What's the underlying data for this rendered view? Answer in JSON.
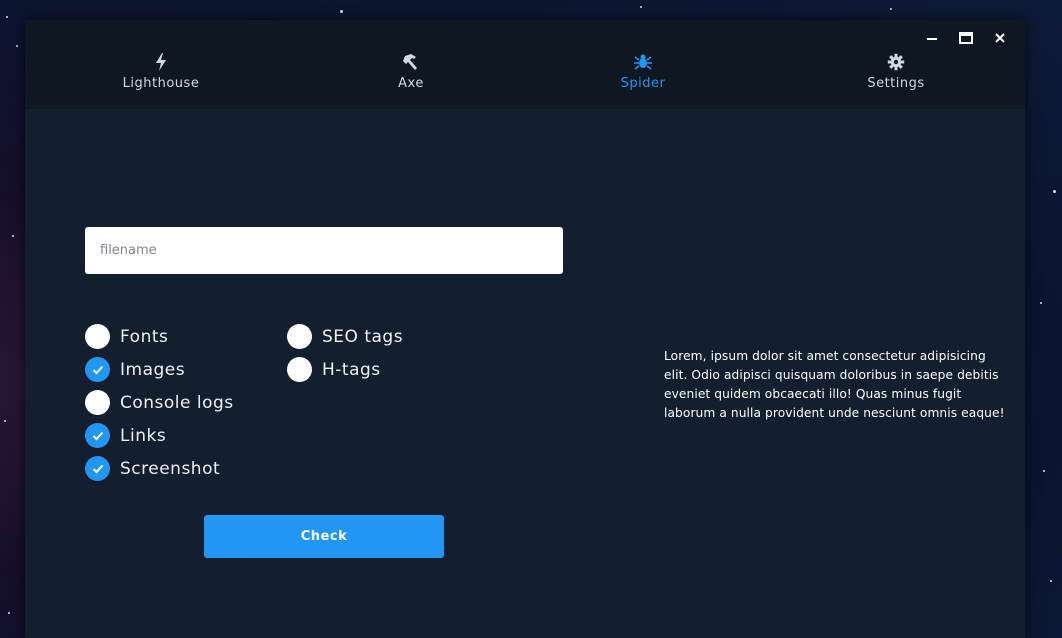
{
  "window": {
    "controls": [
      "minimize-icon",
      "maximize-icon",
      "close-icon"
    ]
  },
  "tabs": [
    {
      "label": "Lighthouse",
      "icon": "bolt-icon",
      "active": false
    },
    {
      "label": "Axe",
      "icon": "hammer-icon",
      "active": false
    },
    {
      "label": "Spider",
      "icon": "spider-icon",
      "active": true
    },
    {
      "label": "Settings",
      "icon": "gear-icon",
      "active": false
    }
  ],
  "form": {
    "filename_placeholder": "filename",
    "filename_value": "",
    "options": [
      {
        "label": "Fonts",
        "checked": false
      },
      {
        "label": "Images",
        "checked": true
      },
      {
        "label": "Console logs",
        "checked": false
      },
      {
        "label": "Links",
        "checked": true
      },
      {
        "label": "Screenshot",
        "checked": true
      },
      {
        "label": "SEO tags",
        "checked": false
      },
      {
        "label": "H-tags",
        "checked": false
      }
    ],
    "check_label": "Check"
  },
  "description": "Lorem, ipsum dolor sit amet consectetur adipisicing elit. Odio adipisci quisquam doloribus in saepe debitis eveniet quidem obcaecati illo! Quas minus fugit laborum a nulla provident unde nesciunt omnis eaque!",
  "colors": {
    "accent": "#2196f3",
    "window_bg": "#131f2e",
    "titlebar_bg": "#0e1822"
  }
}
